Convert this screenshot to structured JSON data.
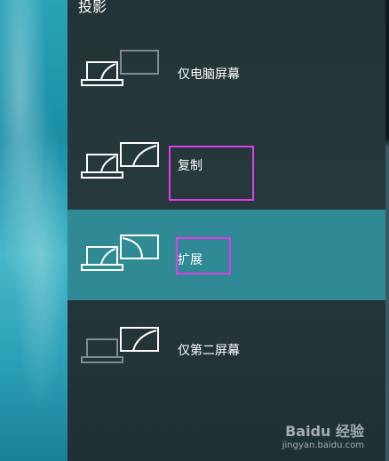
{
  "panel": {
    "title": "投影"
  },
  "options": [
    {
      "label": "仅电脑屏幕",
      "icon": "pc-screen-only-icon"
    },
    {
      "label": "复制",
      "icon": "duplicate-icon"
    },
    {
      "label": "扩展",
      "icon": "extend-icon"
    },
    {
      "label": "仅第二屏幕",
      "icon": "second-screen-only-icon"
    }
  ],
  "watermark": {
    "brand": "Baidu 经验",
    "url": "jingyan.baidu.com"
  },
  "colors": {
    "highlight": "#e03ce8",
    "selected": "#2f8a96",
    "panel": "#233437"
  }
}
